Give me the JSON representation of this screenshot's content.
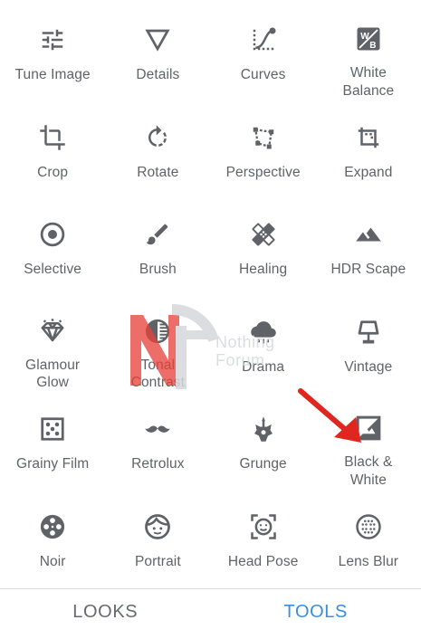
{
  "tools": [
    {
      "name": "tool-tune-image",
      "icon": "sliders-icon",
      "label": "Tune Image"
    },
    {
      "name": "tool-details",
      "icon": "triangle-down-icon",
      "label": "Details"
    },
    {
      "name": "tool-curves",
      "icon": "curves-icon",
      "label": "Curves"
    },
    {
      "name": "tool-white-balance",
      "icon": "white-balance-icon",
      "label": "White\nBalance"
    },
    {
      "name": "tool-crop",
      "icon": "crop-icon",
      "label": "Crop"
    },
    {
      "name": "tool-rotate",
      "icon": "rotate-icon",
      "label": "Rotate"
    },
    {
      "name": "tool-perspective",
      "icon": "perspective-icon",
      "label": "Perspective"
    },
    {
      "name": "tool-expand",
      "icon": "expand-icon",
      "label": "Expand"
    },
    {
      "name": "tool-selective",
      "icon": "selective-icon",
      "label": "Selective"
    },
    {
      "name": "tool-brush",
      "icon": "brush-icon",
      "label": "Brush"
    },
    {
      "name": "tool-healing",
      "icon": "healing-icon",
      "label": "Healing"
    },
    {
      "name": "tool-hdr-scape",
      "icon": "mountains-icon",
      "label": "HDR Scape"
    },
    {
      "name": "tool-glamour-glow",
      "icon": "diamond-icon",
      "label": "Glamour\nGlow"
    },
    {
      "name": "tool-tonal-contrast",
      "icon": "tonal-contrast-icon",
      "label": "Tonal\nContrast"
    },
    {
      "name": "tool-drama",
      "icon": "cloud-rain-icon",
      "label": "Drama"
    },
    {
      "name": "tool-vintage",
      "icon": "lamp-icon",
      "label": "Vintage"
    },
    {
      "name": "tool-grainy-film",
      "icon": "grain-icon",
      "label": "Grainy Film"
    },
    {
      "name": "tool-retrolux",
      "icon": "mustache-icon",
      "label": "Retrolux"
    },
    {
      "name": "tool-grunge",
      "icon": "guitar-icon",
      "label": "Grunge"
    },
    {
      "name": "tool-black-white",
      "icon": "black-white-icon",
      "label": "Black &\nWhite"
    },
    {
      "name": "tool-noir",
      "icon": "film-reel-icon",
      "label": "Noir"
    },
    {
      "name": "tool-portrait",
      "icon": "face-icon",
      "label": "Portrait"
    },
    {
      "name": "tool-head-pose",
      "icon": "face-frame-icon",
      "label": "Head Pose"
    },
    {
      "name": "tool-lens-blur",
      "icon": "lens-blur-icon",
      "label": "Lens Blur"
    }
  ],
  "bottom_nav": {
    "looks": "LOOKS",
    "tools": "TOOLS",
    "active": "tools"
  },
  "watermark": {
    "line1": "Nothing",
    "line2": "Forum"
  },
  "colors": {
    "icon": "#5f6368",
    "label": "#5f6368",
    "active_tab": "#3b8fd9",
    "inactive_tab": "#666a6e",
    "arrow": "#e0261f",
    "watermark_red": "#e8403a",
    "watermark_gray": "#d5d8dc"
  }
}
